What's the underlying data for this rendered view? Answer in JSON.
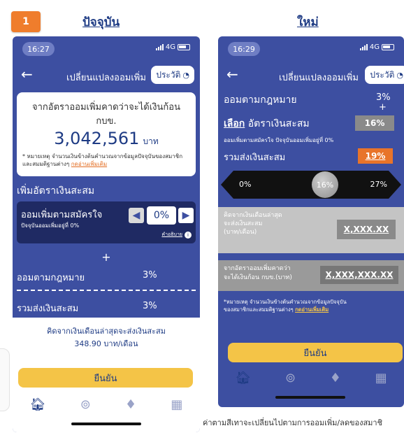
{
  "header": {
    "badge": "1",
    "current_label": "ปัจจุบัน",
    "new_label": "ใหม่"
  },
  "left_phone": {
    "time": "16:27",
    "network": "4G",
    "nav_title": "เปลี่ยนแปลงออมเพิ่ม",
    "history_label": "ประวัติ",
    "card": {
      "line1": "จากอัตราออมเพิ่มคาดว่าจะได้เงินก้อน",
      "line2": "กบข.",
      "amount": "3,042,561",
      "unit": "บาท",
      "note": "* หมายเหตุ จำนวนเงินข้างต้นคำนวณจากข้อมูลปัจจุบันของสมาชิกและสมมติฐานต่างๆ",
      "note_link": "กดอ่านเพิ่มเติม"
    },
    "section_title": "เพิ่มอัตราเงินสะสม",
    "voluntary": {
      "title": "ออมเพิ่มตามสมัครใจ",
      "subtitle": "ปัจจุบันออมเพิ่มอยู่ที่ 0%",
      "value": "0%",
      "help": "คำอธิบาย"
    },
    "plus": "+",
    "legal_label": "ออมตามกฎหมาย",
    "legal_value": "3%",
    "total_label": "รวมส่งเงินสะสม",
    "total_value": "3%",
    "monthly_label": "คิดจากเงินเดือนล่าสุดจะส่งเงินสะสม",
    "monthly_value": "348.90 บาท/เดือน",
    "confirm": "ยืนยัน"
  },
  "right_phone": {
    "time": "16:29",
    "network": "4G",
    "nav_title": "เปลี่ยนแปลงออมเพิ่ม",
    "history_label": "ประวัติ",
    "legal_label": "ออมตามกฎหมาย",
    "legal_value": "3%",
    "plus": "+",
    "choose_link": "เลือก",
    "choose_label": "อัตราเงินสะสม",
    "choose_value": "16%",
    "voluntary_note": "ออมเพิ่มตามสมัครใจ ปัจจุบันออมเพิ่มอยู่ที่ 0%",
    "total_label": "รวมส่งเงินสะสม",
    "total_value": "19%",
    "slider_min": "0%",
    "slider_mid": "16%",
    "slider_max": "27%",
    "slider_level": 0.593,
    "salary_label_1": "คิดจากเงินเดือนล่าสุด",
    "salary_label_2": "จะส่งเงินสะสม",
    "salary_label_3": "(บาท/เดือน)",
    "salary_value": "X,XXX.XX",
    "lump_label_1": "จากอัตราออมเพิ่มคาดว่า",
    "lump_label_2": "จะได้เงินก้อน กบข.(บาท)",
    "lump_value": "X,XXX,XXX.XX",
    "note_line1": "*หมายเหตุ จำนวนเงินข้างต้นคำนวณจากข้อมูลปัจจุบัน",
    "note_line2": "ของสมาชิกและสมมติฐานต่างๆ",
    "note_link": "กดอ่านเพิ่มเติม",
    "confirm": "ยืนยัน"
  },
  "caption": "ค่าตามสีเทาจะเปลี่ยนไปตามการออมเพิ่ม/ลดของสมาชิ",
  "colors": {
    "phone_bg": "#3d4fa1",
    "dark_card": "#1f2a63",
    "accent_orange": "#ef7d2c",
    "button_yellow": "#f4c447",
    "grey_box": "#8a8a8a"
  }
}
